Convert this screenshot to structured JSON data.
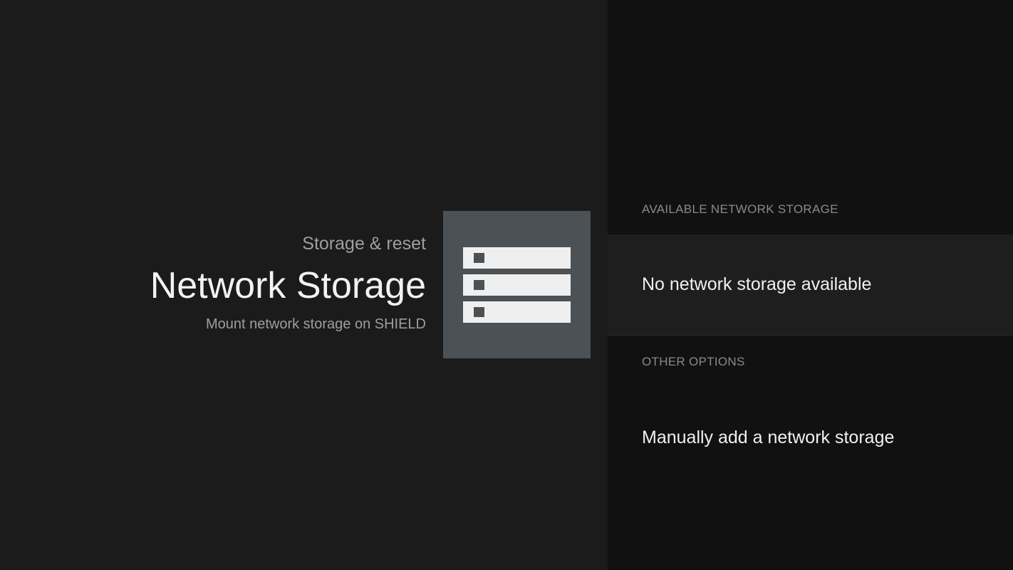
{
  "header": {
    "breadcrumb": "Storage & reset",
    "title": "Network Storage",
    "description": "Mount network storage on SHIELD"
  },
  "icon": {
    "name": "network-storage-icon"
  },
  "list": {
    "available_header": "AVAILABLE NETWORK STORAGE",
    "no_storage_label": "No network storage available",
    "other_header": "OTHER OPTIONS",
    "manual_add_label": "Manually add a network storage"
  },
  "colors": {
    "left_background": "#1b1b1b",
    "right_background": "#111111",
    "tile_background": "#4b5154",
    "title_text": "#f2f2f2",
    "secondary_text": "#9e9e9e"
  }
}
